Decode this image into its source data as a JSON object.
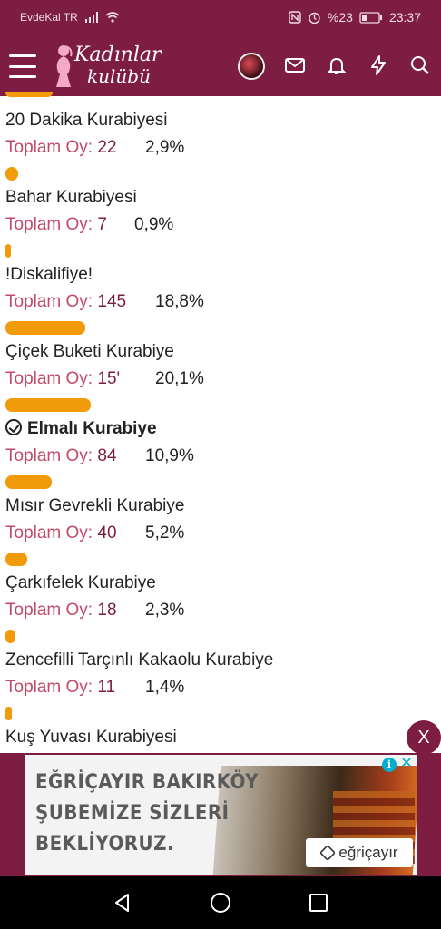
{
  "status": {
    "carrier": "EvdeKal TR",
    "battery": "%23",
    "time": "23:37"
  },
  "header": {
    "logo_line1": "Kadınlar",
    "logo_line2": "kulübü"
  },
  "poll": [
    {
      "name": "20 Dakika Kurabiyesi",
      "vote_label": "Toplam Oy:",
      "count": "22",
      "percent": "2,9%",
      "share": 0.029,
      "selected": false
    },
    {
      "name": "Bahar Kurabiyesi",
      "vote_label": "Toplam Oy:",
      "count": "7",
      "percent": "0,9%",
      "share": 0.009,
      "selected": false
    },
    {
      "name": "!Diskalifiye!",
      "vote_label": "Toplam Oy:",
      "count": "145",
      "percent": "18,8%",
      "share": 0.188,
      "selected": false
    },
    {
      "name": "Çiçek Buketi Kurabiye",
      "vote_label": "Toplam Oy:",
      "count": "15'",
      "percent": "20,1%",
      "share": 0.201,
      "selected": false
    },
    {
      "name": "Elmalı Kurabiye",
      "vote_label": "Toplam Oy:",
      "count": "84",
      "percent": "10,9%",
      "share": 0.109,
      "selected": true
    },
    {
      "name": "Mısır Gevrekli Kurabiye",
      "vote_label": "Toplam Oy:",
      "count": "40",
      "percent": "5,2%",
      "share": 0.052,
      "selected": false
    },
    {
      "name": "Çarkıfelek Kurabiye",
      "vote_label": "Toplam Oy:",
      "count": "18",
      "percent": "2,3%",
      "share": 0.023,
      "selected": false
    },
    {
      "name": "Zencefilli Tarçınlı Kakaolu Kurabiye",
      "vote_label": "Toplam Oy:",
      "count": "11",
      "percent": "1,4%",
      "share": 0.014,
      "selected": false
    },
    {
      "name": "Kuş Yuvası Kurabiyesi"
    }
  ],
  "ad": {
    "line1": "EĞRİÇAYIR BAKIRKÖY",
    "line2": "ŞUBEMİZE SİZLERİ",
    "line3": "BEKLİYORUZ.",
    "brand": "eğriçayır",
    "close_label": "X"
  },
  "colors": {
    "brand": "#7d1d42",
    "bar": "#f19b0a",
    "vote_label": "#c14a6b"
  }
}
